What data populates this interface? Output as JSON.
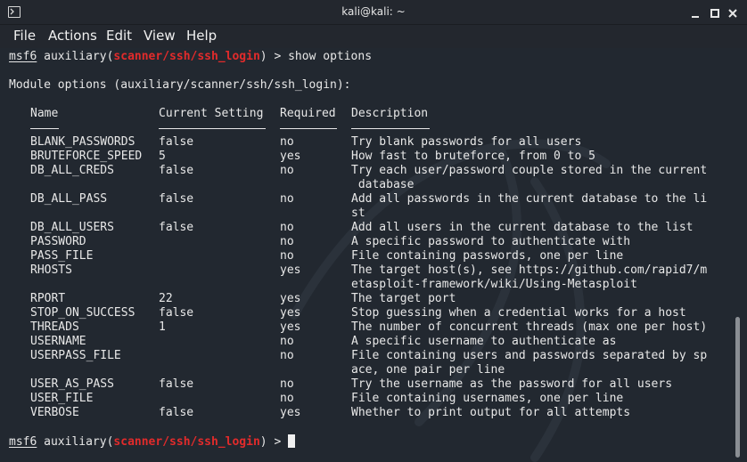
{
  "window": {
    "title": "kali@kali: ~"
  },
  "menu": {
    "items": [
      "File",
      "Actions",
      "Edit",
      "View",
      "Help"
    ]
  },
  "terminal": {
    "prompt_prefix": "msf6",
    "prompt_module_pre": "auxiliary(",
    "module_path": "scanner/ssh/ssh_login",
    "prompt_module_post": ")",
    "prompt_symbol": ">",
    "command": "show options",
    "module_options_header": "Module options (auxiliary/scanner/ssh/ssh_login):",
    "columns": {
      "name": "Name",
      "current": "Current Setting",
      "required": "Required",
      "description": "Description"
    },
    "options": [
      {
        "name": "BLANK_PASSWORDS",
        "current": "false",
        "required": "no",
        "description": [
          "Try blank passwords for all users"
        ]
      },
      {
        "name": "BRUTEFORCE_SPEED",
        "current": "5",
        "required": "yes",
        "description": [
          "How fast to bruteforce, from 0 to 5"
        ]
      },
      {
        "name": "DB_ALL_CREDS",
        "current": "false",
        "required": "no",
        "description": [
          "Try each user/password couple stored in the current",
          " database"
        ]
      },
      {
        "name": "DB_ALL_PASS",
        "current": "false",
        "required": "no",
        "description": [
          "Add all passwords in the current database to the li",
          "st"
        ]
      },
      {
        "name": "DB_ALL_USERS",
        "current": "false",
        "required": "no",
        "description": [
          "Add all users in the current database to the list"
        ]
      },
      {
        "name": "PASSWORD",
        "current": "",
        "required": "no",
        "description": [
          "A specific password to authenticate with"
        ]
      },
      {
        "name": "PASS_FILE",
        "current": "",
        "required": "no",
        "description": [
          "File containing passwords, one per line"
        ]
      },
      {
        "name": "RHOSTS",
        "current": "",
        "required": "yes",
        "description": [
          "The target host(s), see https://github.com/rapid7/m",
          "etasploit-framework/wiki/Using-Metasploit"
        ]
      },
      {
        "name": "RPORT",
        "current": "22",
        "required": "yes",
        "description": [
          "The target port"
        ]
      },
      {
        "name": "STOP_ON_SUCCESS",
        "current": "false",
        "required": "yes",
        "description": [
          "Stop guessing when a credential works for a host"
        ]
      },
      {
        "name": "THREADS",
        "current": "1",
        "required": "yes",
        "description": [
          "The number of concurrent threads (max one per host)"
        ]
      },
      {
        "name": "USERNAME",
        "current": "",
        "required": "no",
        "description": [
          "A specific username to authenticate as"
        ]
      },
      {
        "name": "USERPASS_FILE",
        "current": "",
        "required": "no",
        "description": [
          "File containing users and passwords separated by sp",
          "ace, one pair per line"
        ]
      },
      {
        "name": "USER_AS_PASS",
        "current": "false",
        "required": "no",
        "description": [
          "Try the username as the password for all users"
        ]
      },
      {
        "name": "USER_FILE",
        "current": "",
        "required": "no",
        "description": [
          "File containing usernames, one per line"
        ]
      },
      {
        "name": "VERBOSE",
        "current": "false",
        "required": "yes",
        "description": [
          "Whether to print output for all attempts"
        ]
      }
    ]
  },
  "colors": {
    "background": "#222830",
    "text": "#e8e8e8",
    "module_red": "#e22b2b"
  }
}
